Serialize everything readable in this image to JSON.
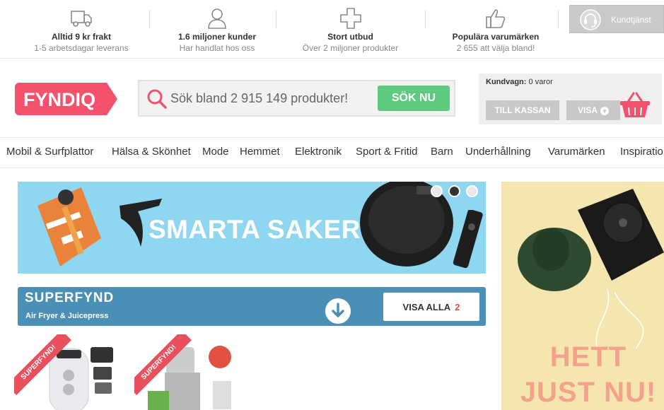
{
  "usp": [
    {
      "icon": "truck-icon",
      "title": "Alltid 9 kr frakt",
      "subtitle": "1-5 arbetsdagar leverans"
    },
    {
      "icon": "user-icon",
      "title": "1.6 miljoner kunder",
      "subtitle": "Har handlat hos oss"
    },
    {
      "icon": "plus-icon",
      "title": "Stort utbud",
      "subtitle": "Över 2 miljoner produkter"
    },
    {
      "icon": "thumbs-up-icon",
      "title": "Populära varumärken",
      "subtitle": "2 655 att välja bland!"
    }
  ],
  "service": {
    "label": "Kundtjänst",
    "icon": "headset-icon"
  },
  "logo": {
    "text": "FYNDIQ",
    "color": "#f4516c"
  },
  "search": {
    "placeholder": "Sök bland 2 915 149 produkter!",
    "button": "SÖK NU"
  },
  "cart": {
    "label": "Kundvagn:",
    "count_text": "0 varor",
    "checkout": "TILL KASSAN",
    "show": "VISA"
  },
  "nav": [
    "Mobil & Surfplattor",
    "Hälsa & Skönhet",
    "Mode",
    "Hemmet",
    "Elektronik",
    "Sport & Fritid",
    "Barn",
    "Underhållning",
    "Varumärken",
    "Inspiration"
  ],
  "hero": {
    "text": "SMARTA SAKER",
    "bg": "#8fd6f0",
    "slides": 3,
    "active_slide": 2
  },
  "superfynd": {
    "title": "SUPERFYND",
    "subtitle": "Air Fryer & Juicepress",
    "view_all": "VISA ALLA",
    "count": "2"
  },
  "products": [
    {
      "ribbon": "SUPERFYND!",
      "name": "air-fryer"
    },
    {
      "ribbon": "SUPERFYND!",
      "name": "juicepress"
    }
  ],
  "side_ad": {
    "line1": "HETT",
    "line2": "JUST NU!"
  },
  "colors": {
    "brand": "#f4516c",
    "search_button": "#5dcb7f",
    "superfynd_bar": "#4a8fb5"
  }
}
